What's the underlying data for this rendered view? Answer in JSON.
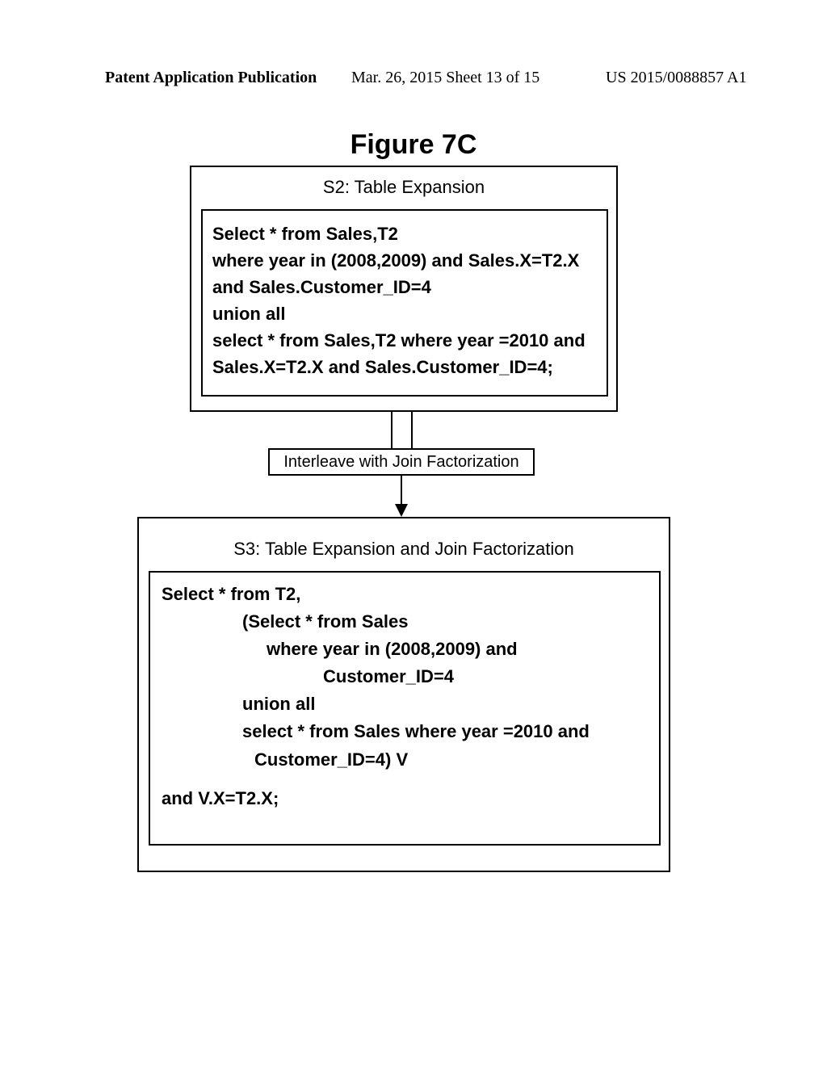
{
  "header": {
    "left": "Patent Application Publication",
    "mid": "Mar. 26, 2015  Sheet 13 of 15",
    "right": "US 2015/0088857 A1"
  },
  "figure_title": "Figure 7C",
  "s2": {
    "title": "S2: Table Expansion",
    "line1": "Select * from Sales,T2",
    "line2": "where  year in (2008,2009) and Sales.X=T2.X",
    "line3": "and Sales.Customer_ID=4",
    "line4": "union all",
    "line5": "select * from Sales,T2 where year =2010 and",
    "line6": "Sales.X=T2.X and Sales.Customer_ID=4;"
  },
  "interleave_label": "Interleave with Join Factorization",
  "s3": {
    "title": "S3: Table Expansion and Join Factorization",
    "line1": "Select * from T2,",
    "line2": "(Select * from Sales",
    "line3": "where  year in (2008,2009) and",
    "line4": "Customer_ID=4",
    "line5": "union all",
    "line6": "select * from Sales where year =2010 and",
    "line7": "Customer_ID=4) V",
    "line8": "and V.X=T2.X;"
  }
}
